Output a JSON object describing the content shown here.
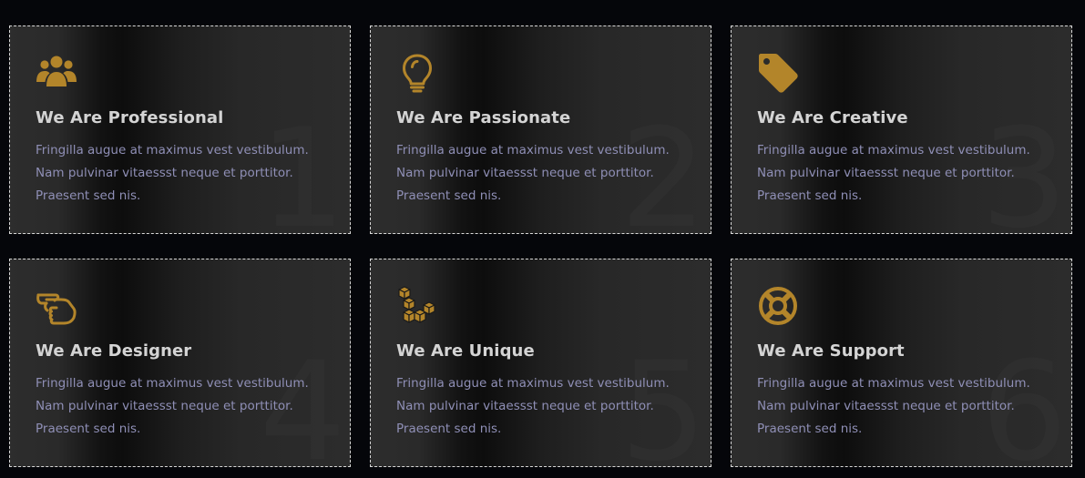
{
  "colors": {
    "background": "#05060a",
    "accent": "#b3852a",
    "title": "#d4d4d4",
    "body_text": "#8f8fb6",
    "border": "#d8d8d8"
  },
  "cards": [
    {
      "icon": "users-icon",
      "title": "We Are Professional",
      "number": "1",
      "lines": [
        "Fringilla augue at maximus vest vestibulum.",
        "Nam pulvinar vitaessst neque et porttitor.",
        "Praesent sed nis."
      ]
    },
    {
      "icon": "lightbulb-icon",
      "title": "We Are Passionate",
      "number": "2",
      "lines": [
        "Fringilla augue at maximus vest vestibulum.",
        "Nam pulvinar vitaessst neque et porttitor.",
        "Praesent sed nis."
      ]
    },
    {
      "icon": "tag-icon",
      "title": "We Are Creative",
      "number": "3",
      "lines": [
        "Fringilla augue at maximus vest vestibulum.",
        "Nam pulvinar vitaessst neque et porttitor.",
        "Praesent sed nis."
      ]
    },
    {
      "icon": "hand-pointing-icon",
      "title": "We Are Designer",
      "number": "4",
      "lines": [
        "Fringilla augue at maximus vest vestibulum.",
        "Nam pulvinar vitaessst neque et porttitor.",
        "Praesent sed nis."
      ]
    },
    {
      "icon": "cubes-icon",
      "title": "We Are Unique",
      "number": "5",
      "lines": [
        "Fringilla augue at maximus vest vestibulum.",
        "Nam pulvinar vitaessst neque et porttitor.",
        "Praesent sed nis."
      ]
    },
    {
      "icon": "life-ring-icon",
      "title": "We Are Support",
      "number": "6",
      "lines": [
        "Fringilla augue at maximus vest vestibulum.",
        "Nam pulvinar vitaessst neque et porttitor.",
        "Praesent sed nis."
      ]
    }
  ]
}
